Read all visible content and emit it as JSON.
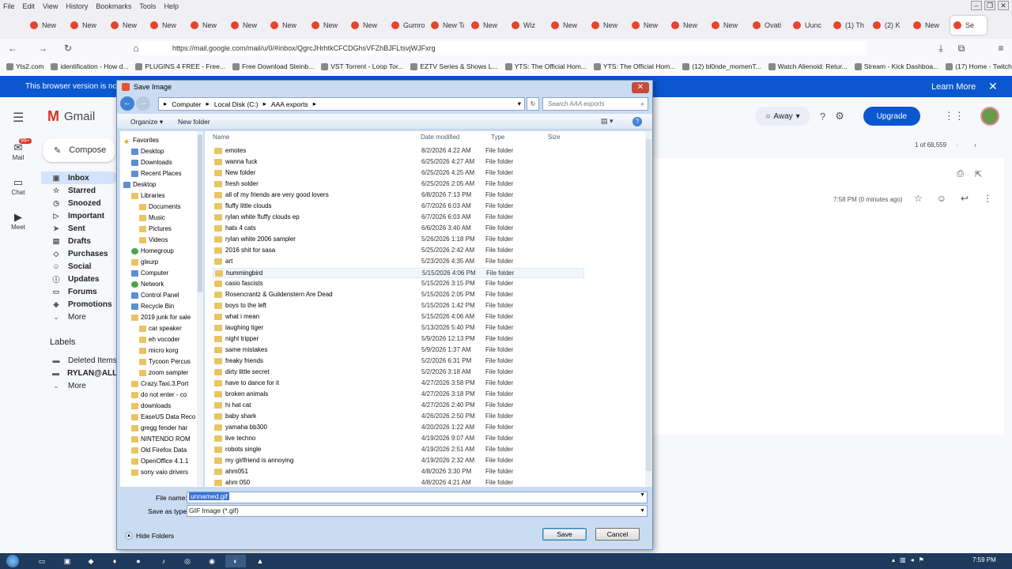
{
  "firefox": {
    "menu": [
      "File",
      "Edit",
      "View",
      "History",
      "Bookmarks",
      "Tools",
      "Help"
    ],
    "tabs": [
      "New",
      "New",
      "New",
      "New",
      "New",
      "New",
      "New",
      "New",
      "New",
      "Gumroad",
      "New Tab",
      "New",
      "Wiz",
      "New",
      "New",
      "New",
      "New",
      "New",
      "Ovati",
      "Uunc",
      "(1) Th",
      "(2) K",
      "New",
      "Se"
    ],
    "url": "https://mail.google.com/mail/u/0/#inbox/QgrcJHrhtkCFCDGhsVFZhBJFLtsvjWJFxrg",
    "bookmarks": [
      "Yts2.com",
      "identification - How d...",
      "PLUGINS 4 FREE - Free...",
      "Free Download Steinb...",
      "VST Torrent - Loop Tor...",
      "EZTV Series & Shows L...",
      "YTS: The Official Hom...",
      "YTS: The Official Hom...",
      "(12) bl0nde_momenT...",
      "Watch Alienoid: Retur...",
      "Stream - Kick Dashboa...",
      "(17) Home - Twitch"
    ]
  },
  "gmail": {
    "banner": "This browser version is no lo",
    "learn_more": "Learn More",
    "logo": "Gmail",
    "rail": [
      {
        "label": "Mail",
        "badge": "99+"
      },
      {
        "label": "Chat"
      },
      {
        "label": "Meet"
      }
    ],
    "compose": "Compose",
    "nav": [
      "Inbox",
      "Starred",
      "Snoozed",
      "Important",
      "Sent",
      "Drafts",
      "Purchases",
      "Social",
      "Updates",
      "Forums",
      "Promotions",
      "More"
    ],
    "labels_title": "Labels",
    "labels": [
      "Deleted Items",
      "RYLAN@ALL",
      "More"
    ],
    "status": "Away",
    "upgrade": "Upgrade",
    "pager": "1 of 68,559",
    "mail_time": "7:58 PM (0 minutes ago)"
  },
  "dialog": {
    "title": "Save Image",
    "path": [
      "Computer",
      "Local Disk (C:)",
      "AAA exports"
    ],
    "search_placeholder": "Search AAA exports",
    "organize": "Organize",
    "new_folder": "New folder",
    "tree": [
      {
        "label": "Favorites",
        "level": 0,
        "kind": "star"
      },
      {
        "label": "Desktop",
        "level": 1,
        "kind": "blue"
      },
      {
        "label": "Downloads",
        "level": 1,
        "kind": "blue"
      },
      {
        "label": "Recent Places",
        "level": 1,
        "kind": "blue"
      },
      {
        "label": "Desktop",
        "level": 0,
        "kind": "blue"
      },
      {
        "label": "Libraries",
        "level": 1,
        "kind": "folder"
      },
      {
        "label": "Documents",
        "level": 2,
        "kind": "folder"
      },
      {
        "label": "Music",
        "level": 2,
        "kind": "folder"
      },
      {
        "label": "Pictures",
        "level": 2,
        "kind": "folder"
      },
      {
        "label": "Videos",
        "level": 2,
        "kind": "folder"
      },
      {
        "label": "Homegroup",
        "level": 1,
        "kind": "green"
      },
      {
        "label": "gleurp",
        "level": 1,
        "kind": "folder"
      },
      {
        "label": "Computer",
        "level": 1,
        "kind": "blue"
      },
      {
        "label": "Network",
        "level": 1,
        "kind": "green"
      },
      {
        "label": "Control Panel",
        "level": 1,
        "kind": "blue"
      },
      {
        "label": "Recycle Bin",
        "level": 1,
        "kind": "blue"
      },
      {
        "label": "2019 junk for sale",
        "level": 1,
        "kind": "folder"
      },
      {
        "label": "car speaker",
        "level": 2,
        "kind": "folder"
      },
      {
        "label": "eh vocoder",
        "level": 2,
        "kind": "folder"
      },
      {
        "label": "micro korg",
        "level": 2,
        "kind": "folder"
      },
      {
        "label": "Tycoon Percus",
        "level": 2,
        "kind": "folder"
      },
      {
        "label": "zoom sampler",
        "level": 2,
        "kind": "folder"
      },
      {
        "label": "Crazy.Taxi.3.Port",
        "level": 1,
        "kind": "folder"
      },
      {
        "label": "do not enter - co",
        "level": 1,
        "kind": "folder"
      },
      {
        "label": "downloads",
        "level": 1,
        "kind": "folder"
      },
      {
        "label": "EaseUS Data Reco",
        "level": 1,
        "kind": "folder"
      },
      {
        "label": "gregg fender har",
        "level": 1,
        "kind": "folder"
      },
      {
        "label": "NINTENDO ROM",
        "level": 1,
        "kind": "folder"
      },
      {
        "label": "Old Firefox Data",
        "level": 1,
        "kind": "folder"
      },
      {
        "label": "OpenOffice 4.1.1",
        "level": 1,
        "kind": "folder"
      },
      {
        "label": "sony vaio drivers",
        "level": 1,
        "kind": "folder"
      }
    ],
    "columns": [
      "Name",
      "Date modified",
      "Type",
      "Size"
    ],
    "files": [
      {
        "name": "emotes",
        "date": "8/2/2026 4:22 AM",
        "type": "File folder"
      },
      {
        "name": "wanna fuck",
        "date": "6/25/2026 4:27 AM",
        "type": "File folder"
      },
      {
        "name": "New folder",
        "date": "6/25/2026 4:25 AM",
        "type": "File folder"
      },
      {
        "name": "fresh solder",
        "date": "6/25/2026 2:05 AM",
        "type": "File folder"
      },
      {
        "name": "all of my friends are very good lovers",
        "date": "6/8/2026 7:13 PM",
        "type": "File folder"
      },
      {
        "name": "fluffy little clouds",
        "date": "6/7/2026 6:03 AM",
        "type": "File folder"
      },
      {
        "name": "rylan white fluffy clouds ep",
        "date": "6/7/2026 6:03 AM",
        "type": "File folder"
      },
      {
        "name": "hats 4 cats",
        "date": "6/6/2026 3:40 AM",
        "type": "File folder"
      },
      {
        "name": "rylan white 2006 sampler",
        "date": "5/26/2026 1:18 PM",
        "type": "File folder"
      },
      {
        "name": "2016 shit for sasa",
        "date": "5/25/2026 2:42 AM",
        "type": "File folder"
      },
      {
        "name": "art",
        "date": "5/23/2026 4:35 AM",
        "type": "File folder"
      },
      {
        "name": "hummingbird",
        "date": "5/15/2026 4:06 PM",
        "type": "File folder"
      },
      {
        "name": "casio fascists",
        "date": "5/15/2026 3:15 PM",
        "type": "File folder"
      },
      {
        "name": "Rosencrantz & Guildenstern Are Dead",
        "date": "5/15/2026 2:05 PM",
        "type": "File folder"
      },
      {
        "name": "boys to the left",
        "date": "5/15/2026 1:42 PM",
        "type": "File folder"
      },
      {
        "name": "what i mean",
        "date": "5/15/2026 4:06 AM",
        "type": "File folder"
      },
      {
        "name": "laughing tiger",
        "date": "5/13/2026 5:40 PM",
        "type": "File folder"
      },
      {
        "name": "night tripper",
        "date": "5/9/2026 12:13 PM",
        "type": "File folder"
      },
      {
        "name": "same mistakes",
        "date": "5/9/2026 1:37 AM",
        "type": "File folder"
      },
      {
        "name": "freaky friends",
        "date": "5/2/2026 6:31 PM",
        "type": "File folder"
      },
      {
        "name": "dirty little secret",
        "date": "5/2/2026 3:18 AM",
        "type": "File folder"
      },
      {
        "name": "have to dance for it",
        "date": "4/27/2026 3:58 PM",
        "type": "File folder"
      },
      {
        "name": "broken animals",
        "date": "4/27/2026 3:18 PM",
        "type": "File folder"
      },
      {
        "name": "hi hat cat",
        "date": "4/27/2026 2:40 PM",
        "type": "File folder"
      },
      {
        "name": "baby shark",
        "date": "4/26/2026 2:50 PM",
        "type": "File folder"
      },
      {
        "name": "yamaha bb300",
        "date": "4/20/2026 1:22 AM",
        "type": "File folder"
      },
      {
        "name": "live techno",
        "date": "4/19/2026 9:07 AM",
        "type": "File folder"
      },
      {
        "name": "robots single",
        "date": "4/19/2026 2:51 AM",
        "type": "File folder"
      },
      {
        "name": "my girlfriend is annoying",
        "date": "4/19/2026 2:32 AM",
        "type": "File folder"
      },
      {
        "name": "ahm051",
        "date": "4/8/2026 3:30 PM",
        "type": "File folder"
      },
      {
        "name": "ahm 050",
        "date": "4/8/2026 4:21 AM",
        "type": "File folder"
      }
    ],
    "hover_index": 11,
    "file_name_label": "File name:",
    "file_name_value": "unnamed.gif",
    "save_type_label": "Save as type:",
    "save_type_value": "GIF Image (*.gif)",
    "hide_folders": "Hide Folders",
    "save": "Save",
    "cancel": "Cancel"
  },
  "taskbar": {
    "clock": "7:59 PM"
  }
}
